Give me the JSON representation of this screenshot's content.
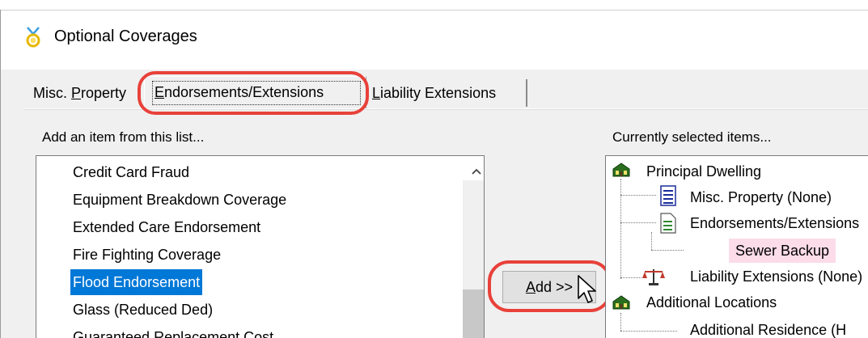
{
  "window": {
    "title": "Optional Coverages",
    "icon": "medal-icon"
  },
  "tabs": [
    {
      "label_pre": "Misc. ",
      "label_key": "P",
      "label_post": "roperty",
      "active": false
    },
    {
      "label_pre": "",
      "label_key": "E",
      "label_post": "ndorsements/Extensions",
      "active": true
    },
    {
      "label_pre": "",
      "label_key": "L",
      "label_post": "iability Extensions",
      "active": false
    }
  ],
  "available": {
    "label": "Add an item from this list...",
    "items": [
      "Credit Card Fraud",
      "Equipment Breakdown Coverage",
      "Extended Care Endorsement",
      "Fire Fighting Coverage",
      "Flood Endorsement",
      "Glass (Reduced Ded)",
      "Guaranteed Replacement Cost"
    ],
    "selected_index": 4
  },
  "add_button": {
    "key": "A",
    "rest": "dd >>"
  },
  "selected": {
    "label": "Currently selected items...",
    "tree": {
      "principal": "Principal Dwelling",
      "misc": "Misc. Property (None)",
      "endorsements": "Endorsements/Extensions",
      "sewer": "Sewer Backup",
      "liability": "Liability Extensions (None)",
      "additional": "Additional Locations",
      "residence": "Additional Residence (H"
    }
  },
  "colors": {
    "highlight_red": "#e8413a",
    "selection_blue": "#0078d7",
    "sewer_bg": "#fbdce8"
  }
}
